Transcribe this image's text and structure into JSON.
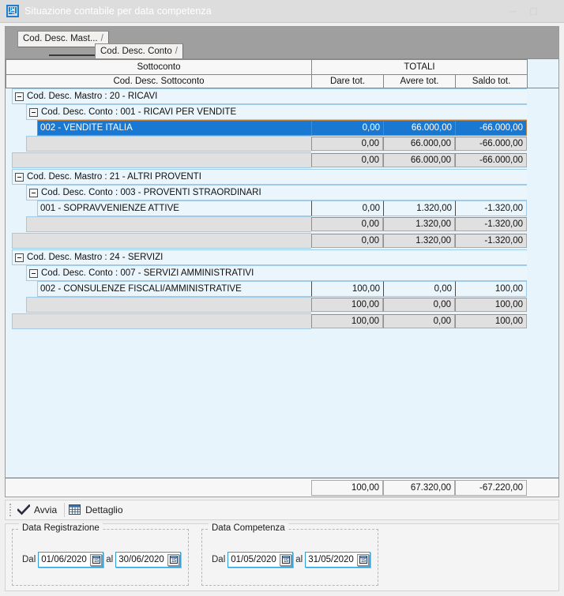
{
  "window": {
    "title": "Situazione contabile per data competenza",
    "icon": "app-barcode-icon",
    "controls": {
      "minimize": "–",
      "maximize": "□",
      "close": "✕"
    }
  },
  "group_panel": {
    "chips": [
      {
        "label": "Cod. Desc. Mast...",
        "slash": "/"
      },
      {
        "label": "Cod. Desc. Conto",
        "slash": "/"
      }
    ]
  },
  "grid": {
    "header_top": {
      "sottoconto": "Sottoconto",
      "totali": "TOTALI"
    },
    "header_sub": {
      "cod_desc": "Cod. Desc. Sottoconto",
      "dare": "Dare tot.",
      "avere": "Avere tot.",
      "saldo": "Saldo tot."
    },
    "groups": [
      {
        "mastro": "Cod. Desc. Mastro : 20 - RICAVI",
        "conto": "Cod. Desc. Conto : 001 - RICAVI PER VENDITE",
        "rows": [
          {
            "label": "002 - VENDITE  ITALIA",
            "dare": "0,00",
            "avere": "66.000,00",
            "saldo": "-66.000,00",
            "selected": true
          }
        ],
        "conto_total": {
          "dare": "0,00",
          "avere": "66.000,00",
          "saldo": "-66.000,00"
        },
        "mastro_total": {
          "dare": "0,00",
          "avere": "66.000,00",
          "saldo": "-66.000,00"
        }
      },
      {
        "mastro": "Cod. Desc. Mastro : 21 - ALTRI PROVENTI",
        "conto": "Cod. Desc. Conto : 003 - PROVENTI STRAORDINARI",
        "rows": [
          {
            "label": "001 - SOPRAVVENIENZE ATTIVE",
            "dare": "0,00",
            "avere": "1.320,00",
            "saldo": "-1.320,00",
            "selected": false
          }
        ],
        "conto_total": {
          "dare": "0,00",
          "avere": "1.320,00",
          "saldo": "-1.320,00"
        },
        "mastro_total": {
          "dare": "0,00",
          "avere": "1.320,00",
          "saldo": "-1.320,00"
        }
      },
      {
        "mastro": "Cod. Desc. Mastro : 24 - SERVIZI",
        "conto": "Cod. Desc. Conto : 007 - SERVIZI AMMINISTRATIVI",
        "rows": [
          {
            "label": "002 - CONSULENZE FISCALI/AMMINISTRATIVE",
            "dare": "100,00",
            "avere": "0,00",
            "saldo": "100,00",
            "selected": false
          }
        ],
        "conto_total": {
          "dare": "100,00",
          "avere": "0,00",
          "saldo": "100,00"
        },
        "mastro_total": {
          "dare": "100,00",
          "avere": "0,00",
          "saldo": "100,00"
        }
      }
    ],
    "grand_total": {
      "dare": "100,00",
      "avere": "67.320,00",
      "saldo": "-67.220,00"
    }
  },
  "toolbar": {
    "avvia_label": "Avvia",
    "avvia_icon": "check-icon",
    "dettaglio_label": "Dettaglio",
    "dettaglio_icon": "grid-icon"
  },
  "filters": {
    "registrazione": {
      "legend": "Data Registrazione",
      "from_label": "Dal",
      "from_value": "01/06/2020",
      "to_label": "al",
      "to_value": "30/06/2020",
      "calendar_icon": "calendar-icon"
    },
    "competenza": {
      "legend": "Data Competenza",
      "from_label": "Dal",
      "from_value": "01/05/2020",
      "to_label": "al",
      "to_value": "31/05/2020",
      "calendar_icon": "calendar-icon"
    }
  },
  "colors": {
    "selection": "#1878d2",
    "focus_border": "#c08040",
    "grid_bg": "#e8f4fb",
    "subtotal_bg": "#e0e0e0",
    "titlebar_bg": "#dedddd",
    "panel_bg": "#9f9f9f",
    "input_border": "#2e9fd6"
  }
}
